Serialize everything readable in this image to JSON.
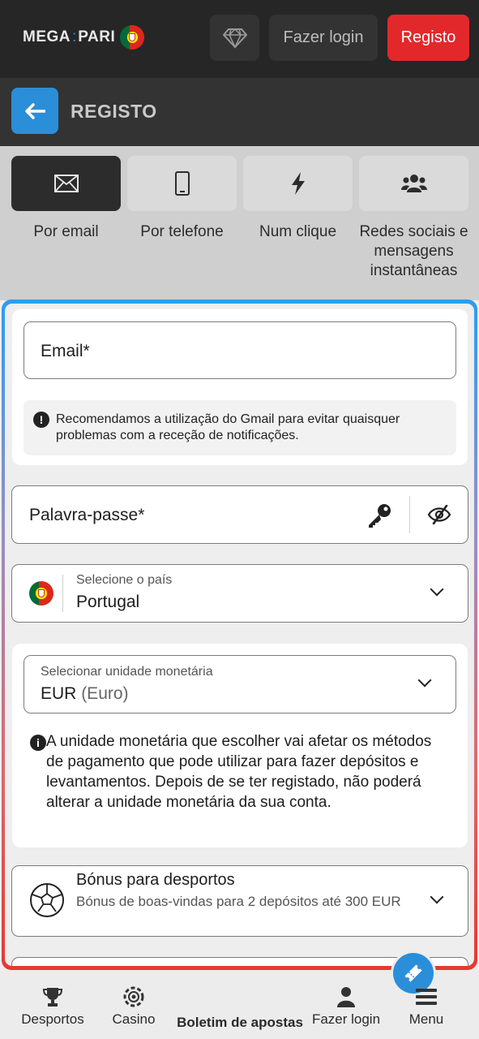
{
  "header": {
    "logo_left": "MEGA",
    "logo_sep": ":",
    "logo_right": "PARI",
    "login_label": "Fazer login",
    "register_label": "Registo",
    "colors": {
      "register": "#e3282b",
      "accent": "#2b8ed9"
    }
  },
  "title_bar": {
    "title": "REGISTO"
  },
  "tabs": [
    {
      "label": "Por email",
      "icon": "envelope-icon",
      "active": true
    },
    {
      "label": "Por telefone",
      "icon": "smartphone-icon"
    },
    {
      "label": "Num clique",
      "icon": "lightning-icon"
    },
    {
      "label": "Redes sociais e mensagens instantâneas",
      "icon": "people-icon"
    }
  ],
  "form": {
    "email_placeholder": "Email*",
    "email_notice": "Recomendamos a utilização do Gmail para evitar quaisquer problemas com a receção de notificações.",
    "password_placeholder": "Palavra-passe*",
    "country_label": "Selecione o país",
    "country_value": "Portugal",
    "currency_label": "Selecionar unidade monetária",
    "currency_code": "EUR",
    "currency_name": "(Euro)",
    "currency_notice": "A unidade monetária que escolher vai afetar os métodos de pagamento que pode utilizar para fazer depósitos e levantamentos. Depois de se ter registado, não poderá alterar a unidade monetária da sua conta.",
    "bonus_title": "Bónus para desportos",
    "bonus_subtitle": "Bónus de boas-vindas para 2 depósitos até 300 EUR"
  },
  "bottom_nav": [
    {
      "label": "Desportos",
      "icon": "trophy-icon"
    },
    {
      "label": "Casino",
      "icon": "casino-chip-icon"
    },
    {
      "label": "Boletim de apostas",
      "icon": "ticket-icon"
    },
    {
      "label": "Fazer login",
      "icon": "user-icon"
    },
    {
      "label": "Menu",
      "icon": "hamburger-icon"
    }
  ]
}
